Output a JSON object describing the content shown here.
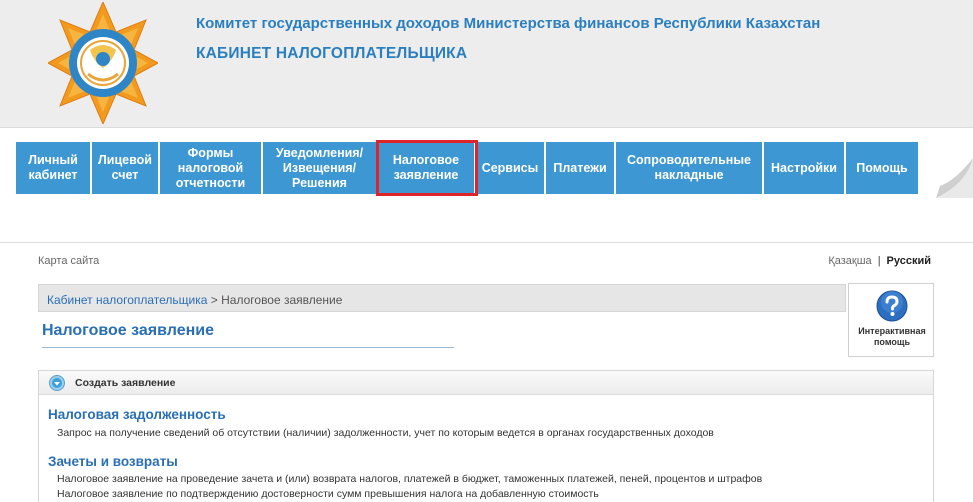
{
  "header": {
    "org_title": "Комитет государственных доходов Министерства финансов Республики Казахстан",
    "cabinet_title": "КАБИНЕТ НАЛОГОПЛАТЕЛЬЩИКА"
  },
  "nav": {
    "items": [
      {
        "label": "Личный\nкабинет"
      },
      {
        "label": "Лицевой\nсчет"
      },
      {
        "label": "Формы\nналоговой\nотчетности"
      },
      {
        "label": "Уведомления/\nИзвещения/\nРешения"
      },
      {
        "label": "Налоговое\nзаявление"
      },
      {
        "label": "Сервисы"
      },
      {
        "label": "Платежи"
      },
      {
        "label": "Сопроводительные\nнакладные"
      },
      {
        "label": "Настройки"
      },
      {
        "label": "Помощь"
      }
    ],
    "active_index": 4
  },
  "links": {
    "sitemap": "Карта сайта",
    "lang_kz": "Қазақша",
    "lang_sep": "|",
    "lang_ru": "Русский"
  },
  "breadcrumb": {
    "root": "Кабинет налогоплательщика",
    "sep": " > ",
    "current": "Налоговое заявление"
  },
  "page": {
    "title": "Налоговое заявление"
  },
  "help": {
    "label": "Интерактивная помощь"
  },
  "panel": {
    "header": "Создать заявление",
    "sections": [
      {
        "title": "Налоговая задолженность",
        "links": [
          "Запрос на получение сведений об отсутствии (наличии) задолженности, учет по которым ведется в органах государственных доходов"
        ]
      },
      {
        "title": "Зачеты и возвраты",
        "links": [
          "Налоговое заявление на проведение зачета и (или) возврата налогов, платежей в бюджет, таможенных платежей, пеней, процентов и штрафов",
          "Налоговое заявление по подтверждению достоверности сумм превышения налога на добавленную стоимость"
        ]
      }
    ]
  },
  "colors": {
    "nav_bg": "#3d97d3",
    "accent": "#2a6fb5",
    "active_outline": "#e0242c",
    "logo_orange": "#f29a1e"
  }
}
